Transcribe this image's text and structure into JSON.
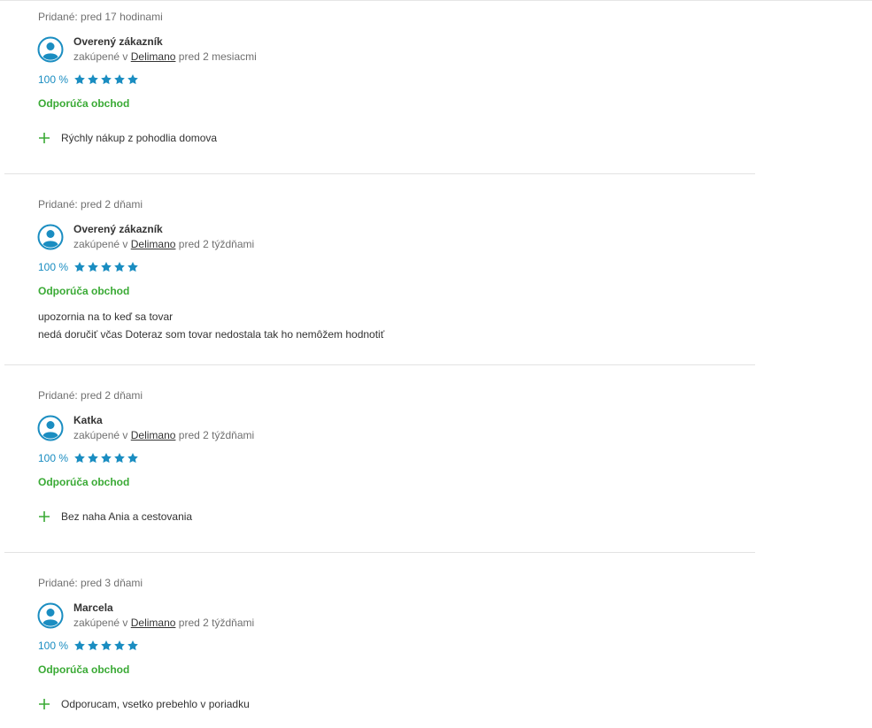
{
  "colors": {
    "accent_blue": "#1a8dc1",
    "recommend_green": "#3aaa35",
    "muted_text": "#707070"
  },
  "reviews": [
    {
      "added": "Pridané: pred 17 hodinami",
      "user": "Overený zákazník",
      "bought_prefix": "zakúpené v",
      "shop": "Delimano",
      "bought_suffix": "pred 2 mesiacmi",
      "percent": "100 %",
      "stars": 5,
      "recommend": "Odporúča obchod",
      "pro": "Rýchly nákup z pohodlia domova"
    },
    {
      "added": "Pridané: pred 2 dňami",
      "user": "Overený zákazník",
      "bought_prefix": "zakúpené v",
      "shop": "Delimano",
      "bought_suffix": "pred 2 týždňami",
      "percent": "100 %",
      "stars": 5,
      "recommend": "Odporúča obchod",
      "comment_line1": "upozornia na to keď sa tovar",
      "comment_line2": "nedá doručiť včas Doteraz som tovar nedostala tak ho nemôžem hodnotiť"
    },
    {
      "added": "Pridané: pred 2 dňami",
      "user": "Katka",
      "bought_prefix": "zakúpené v",
      "shop": "Delimano",
      "bought_suffix": "pred 2 týždňami",
      "percent": "100 %",
      "stars": 5,
      "recommend": "Odporúča obchod",
      "pro": "Bez naha Ania a cestovania"
    },
    {
      "added": "Pridané: pred 3 dňami",
      "user": "Marcela",
      "bought_prefix": "zakúpené v",
      "shop": "Delimano",
      "bought_suffix": "pred 2 týždňami",
      "percent": "100 %",
      "stars": 5,
      "recommend": "Odporúča obchod",
      "pro": "Odporucam, vsetko prebehlo v poriadku"
    }
  ]
}
